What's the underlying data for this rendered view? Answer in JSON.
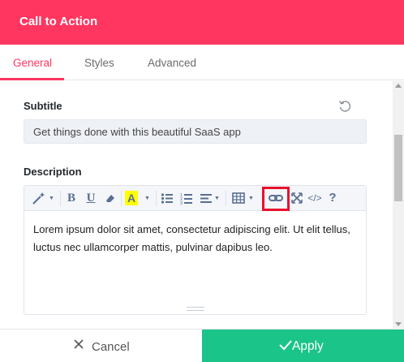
{
  "header": {
    "title": "Call to Action"
  },
  "tabs": [
    {
      "label": "General",
      "active": true
    },
    {
      "label": "Styles",
      "active": false
    },
    {
      "label": "Advanced",
      "active": false
    }
  ],
  "fields": {
    "subtitle": {
      "label": "Subtitle",
      "value": "Get things done with this beautiful SaaS app"
    },
    "description": {
      "label": "Description",
      "body": "Lorem ipsum dolor sit amet, consectetur adipiscing elit. Ut elit tellus, luctus nec ullamcorper mattis, pulvinar dapibus leo."
    }
  },
  "toolbar": {
    "bold": "B",
    "underline": "U",
    "highlight": "A",
    "code": "</>",
    "help": "?"
  },
  "footer": {
    "cancel_label": "Cancel",
    "apply_label": "Apply"
  },
  "colors": {
    "brand": "#ff3660",
    "apply": "#1bc489",
    "highlight_box": "#e8112d"
  }
}
